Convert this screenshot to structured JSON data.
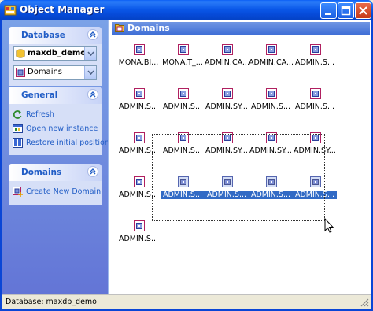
{
  "window": {
    "title": "Object Manager"
  },
  "sidebar": {
    "database": {
      "title": "Database",
      "connection_value": "maxdb_demo",
      "objecttype_value": "Domains"
    },
    "general": {
      "title": "General",
      "items": [
        {
          "label": "Refresh",
          "icon": "refresh-icon"
        },
        {
          "label": "Open new instance",
          "icon": "new-instance-icon"
        },
        {
          "label": "Restore initial position",
          "icon": "restore-position-icon"
        }
      ]
    },
    "domains": {
      "title": "Domains",
      "items": [
        {
          "label": "Create New Domain",
          "icon": "create-domain-icon"
        }
      ]
    }
  },
  "main": {
    "header_title": "Domains",
    "items": [
      {
        "label": "MONA.BI...",
        "selected": false
      },
      {
        "label": "MONA.T_...",
        "selected": false
      },
      {
        "label": "ADMIN.CA...",
        "selected": false
      },
      {
        "label": "ADMIN.CA...",
        "selected": false
      },
      {
        "label": "ADMIN.S...",
        "selected": false
      },
      {
        "label": "ADMIN.S...",
        "selected": false
      },
      {
        "label": "ADMIN.S...",
        "selected": false
      },
      {
        "label": "ADMIN.SY...",
        "selected": false
      },
      {
        "label": "ADMIN.S...",
        "selected": false
      },
      {
        "label": "ADMIN.S...",
        "selected": false
      },
      {
        "label": "ADMIN.S...",
        "selected": false
      },
      {
        "label": "ADMIN.S...",
        "selected": false
      },
      {
        "label": "ADMIN.SY...",
        "selected": false
      },
      {
        "label": "ADMIN.SY...",
        "selected": false
      },
      {
        "label": "ADMIN.SY...",
        "selected": false
      },
      {
        "label": "ADMIN.S...",
        "selected": false
      },
      {
        "label": "ADMIN.S...",
        "selected": true
      },
      {
        "label": "ADMIN.S...",
        "selected": true
      },
      {
        "label": "ADMIN.S...",
        "selected": true
      },
      {
        "label": "ADMIN.S...",
        "selected": true
      },
      {
        "label": "ADMIN.S...",
        "selected": false
      }
    ]
  },
  "statusbar": {
    "text": "Database: maxdb_demo"
  },
  "colors": {
    "title_bar": "#0a58e9",
    "sidebar_bg": "#6e8fe0",
    "panel_title": "#215dc6",
    "selection": "#316ac5"
  }
}
